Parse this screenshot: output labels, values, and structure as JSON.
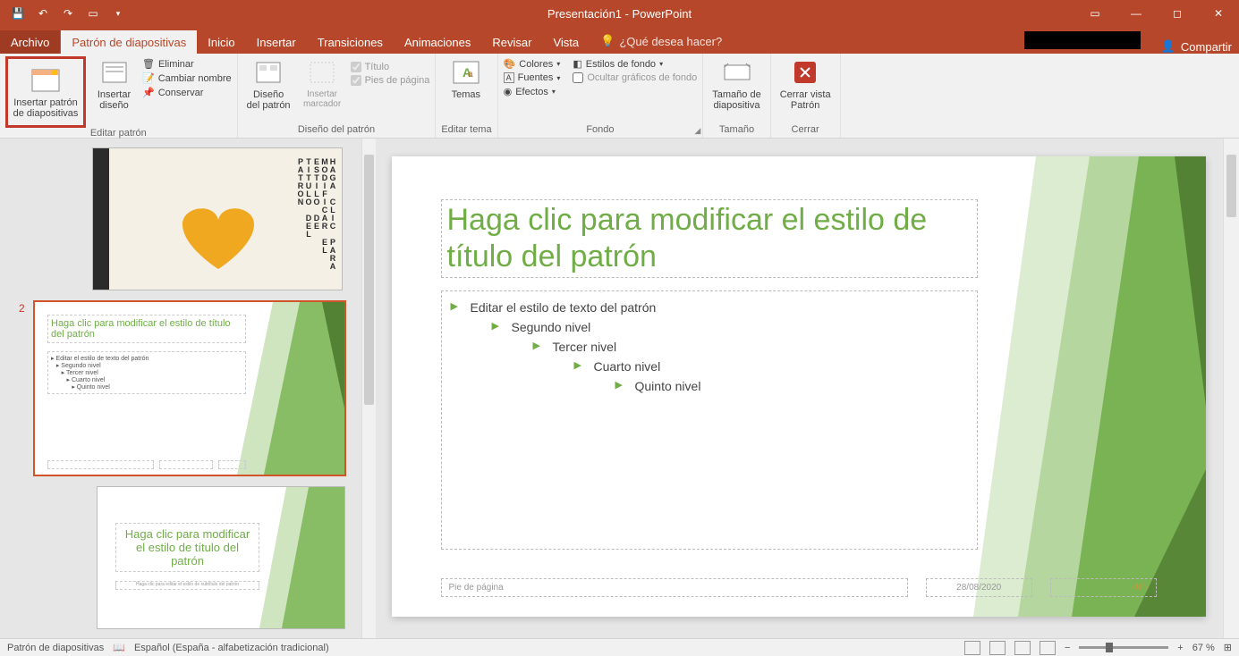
{
  "title": "Presentación1 - PowerPoint",
  "tabs": {
    "file": "Archivo",
    "master": "Patrón de diapositivas",
    "home": "Inicio",
    "insert": "Insertar",
    "trans": "Transiciones",
    "anim": "Animaciones",
    "review": "Revisar",
    "view": "Vista"
  },
  "tellme": "¿Qué desea hacer?",
  "share": "Compartir",
  "ribbon": {
    "insert_master": "Insertar patrón\nde diapositivas",
    "insert_layout": "Insertar\ndiseño",
    "delete": "Eliminar",
    "rename": "Cambiar nombre",
    "preserve": "Conservar",
    "edit_master_grp": "Editar patrón",
    "master_layout": "Diseño\ndel patrón",
    "insert_ph": "Insertar\nmarcador",
    "title_chk": "Título",
    "footers_chk": "Pies de página",
    "master_layout_grp": "Diseño del patrón",
    "themes": "Temas",
    "edit_theme_grp": "Editar tema",
    "colors": "Colores",
    "fonts": "Fuentes",
    "effects": "Efectos",
    "bg_styles": "Estilos de fondo",
    "hide_bg": "Ocultar gráficos de fondo",
    "bg_grp": "Fondo",
    "slide_size": "Tamaño de\ndiapositiva",
    "size_grp": "Tamaño",
    "close_master": "Cerrar vista\nPatrón",
    "close_grp": "Cerrar"
  },
  "slide": {
    "title": "Haga clic para modificar el estilo de título del patrón",
    "l1": "Editar el estilo de texto del patrón",
    "l2": "Segundo nivel",
    "l3": "Tercer nivel",
    "l4": "Cuarto nivel",
    "l5": "Quinto nivel",
    "footer": "Pie de página",
    "date": "28/08/2020",
    "num": "‹N°›"
  },
  "thumb2_num": "2",
  "thumb3_title": "Haga clic para modificar el estilo de título del patrón",
  "status": {
    "view": "Patrón de diapositivas",
    "lang": "Español (España - alfabetización tradicional)",
    "zoom": "67 %"
  }
}
